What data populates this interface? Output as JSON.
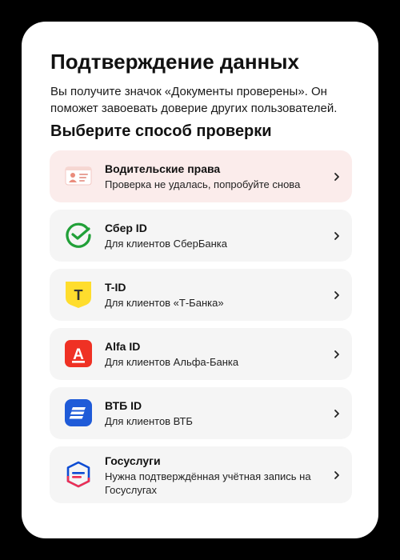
{
  "header": {
    "title": "Подтверждение данных",
    "subtitle": "Вы получите значок «Документы проверены». Он поможет завоевать доверие других пользователей.",
    "section_title": "Выберите способ проверки"
  },
  "options": [
    {
      "title": "Водительские права",
      "subtitle": "Проверка не удалась, попробуйте снова",
      "icon": "driver-license-icon",
      "status": "error"
    },
    {
      "title": "Сбер ID",
      "subtitle": "Для клиентов СберБанка",
      "icon": "sber-logo-icon"
    },
    {
      "title": "T-ID",
      "subtitle": "Для клиентов «Т-Банка»",
      "icon": "tbank-logo-icon",
      "logo_text": "T"
    },
    {
      "title": "Alfa ID",
      "subtitle": "Для клиентов Альфа-Банка",
      "icon": "alfa-logo-icon",
      "logo_text": "А"
    },
    {
      "title": "ВТБ ID",
      "subtitle": "Для клиентов ВТБ",
      "icon": "vtb-logo-icon"
    },
    {
      "title": "Госуслуги",
      "subtitle": "Нужна подтверждённая учётная запись на Госуслугах",
      "icon": "gosuslugi-logo-icon"
    }
  ],
  "colors": {
    "error_bg": "#fbeceb",
    "option_bg": "#f5f5f5",
    "sber_green": "#21a038",
    "tbank_yellow": "#ffdd2d",
    "alfa_red": "#ef3124",
    "vtb_blue": "#1f5bd8",
    "gosuslugi_blue": "#0d4cd3",
    "gosuslugi_red": "#ee2f53"
  }
}
